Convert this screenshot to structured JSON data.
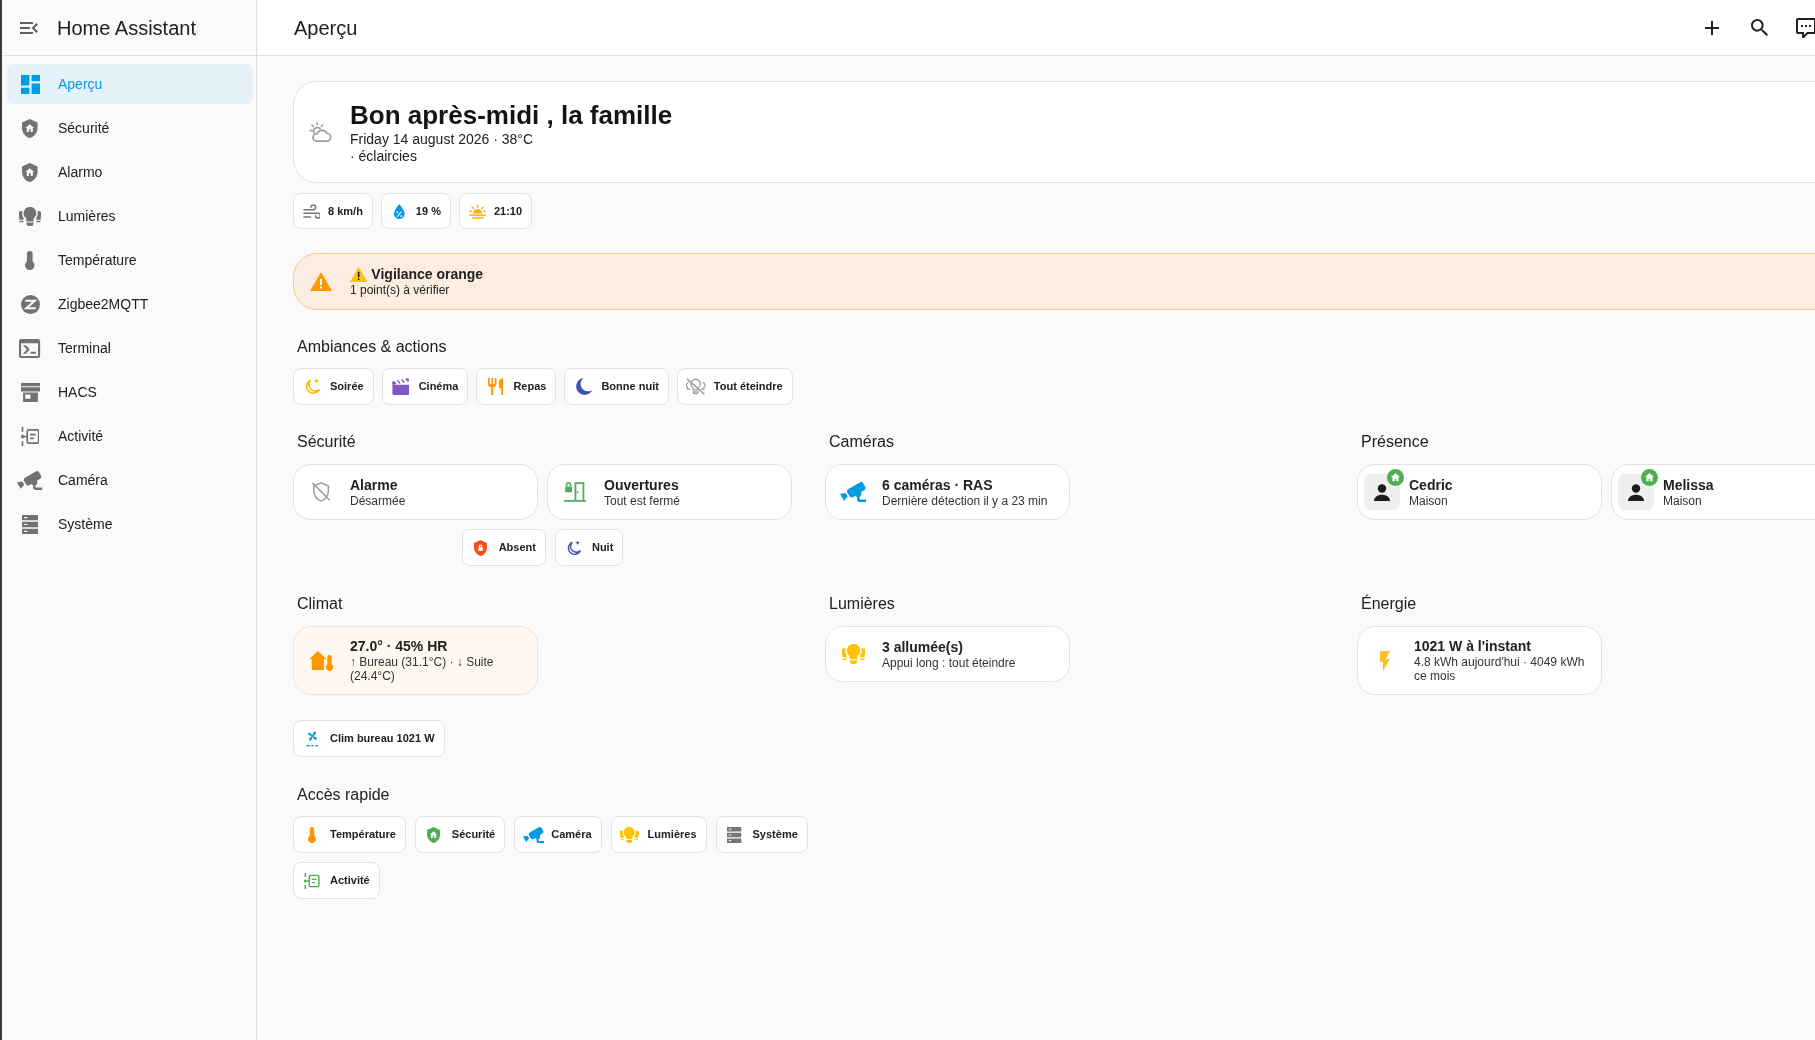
{
  "sidebar": {
    "title": "Home Assistant",
    "items": [
      {
        "label": "Aperçu",
        "selected": true
      },
      {
        "label": "Sécurité",
        "selected": false
      },
      {
        "label": "Alarmo",
        "selected": false
      },
      {
        "label": "Lumières",
        "selected": false
      },
      {
        "label": "Température",
        "selected": false
      },
      {
        "label": "Zigbee2MQTT",
        "selected": false
      },
      {
        "label": "Terminal",
        "selected": false
      },
      {
        "label": "HACS",
        "selected": false
      },
      {
        "label": "Activité",
        "selected": false
      },
      {
        "label": "Caméra",
        "selected": false
      },
      {
        "label": "Système",
        "selected": false
      }
    ]
  },
  "header": {
    "title": "Aperçu"
  },
  "greeting": {
    "title": "Bon après-midi , la famille",
    "date_line": "Friday 14 august 2026 · 38°C",
    "condition": "· éclaircies"
  },
  "weather_chips": [
    {
      "label": "8 km/h"
    },
    {
      "label": "19 %"
    },
    {
      "label": "21:10"
    }
  ],
  "alert": {
    "title": "Vigilance orange",
    "subtitle": "1 point(s) à vérifier"
  },
  "scenes": {
    "title": "Ambiances & actions",
    "buttons": [
      {
        "label": "Soirée"
      },
      {
        "label": "Cinéma"
      },
      {
        "label": "Repas"
      },
      {
        "label": "Bonne nuit"
      },
      {
        "label": "Tout éteindre"
      }
    ]
  },
  "sections": [
    {
      "title": "Sécurité",
      "cards": [
        {
          "title": "Alarme",
          "subtitle": "Désarmée",
          "highlighted": false
        },
        {
          "title": "Ouvertures",
          "subtitle": "Tout est fermé",
          "highlighted": false
        }
      ],
      "chips": [
        {
          "label": "Absent"
        },
        {
          "label": "Nuit"
        }
      ]
    },
    {
      "title": "Caméras",
      "cards": [
        {
          "title": "6 caméras · RAS",
          "subtitle": "Dernière détection il y a 23 min",
          "highlighted": false
        }
      ]
    },
    {
      "title": "Présence",
      "people": [
        {
          "name": "Cedric",
          "location": "Maison",
          "home": true
        },
        {
          "name": "Melissa",
          "location": "Maison",
          "home": true
        }
      ]
    },
    {
      "title": "Climat",
      "cards": [
        {
          "title": "27.0° · 45% HR",
          "subtitle": "↑ Bureau (31.1°C) · ↓ Suite (24.4°C)",
          "highlighted": true
        }
      ],
      "chips": [
        {
          "label": "Clim bureau 1021 W"
        }
      ]
    },
    {
      "title": "Lumières",
      "cards": [
        {
          "title": "3 allumée(s)",
          "subtitle": "Appui long : tout éteindre",
          "highlighted": false
        }
      ]
    },
    {
      "title": "Énergie",
      "cards": [
        {
          "title": "1021 W à l'instant",
          "subtitle": "4.8 kWh aujourd'hui · 4049 kWh ce mois",
          "highlighted": false
        }
      ]
    }
  ],
  "quick_access": {
    "title": "Accès rapide",
    "buttons": [
      {
        "label": "Température"
      },
      {
        "label": "Sécurité"
      },
      {
        "label": "Caméra"
      },
      {
        "label": "Lumières"
      },
      {
        "label": "Système"
      },
      {
        "label": "Activité"
      }
    ]
  }
}
